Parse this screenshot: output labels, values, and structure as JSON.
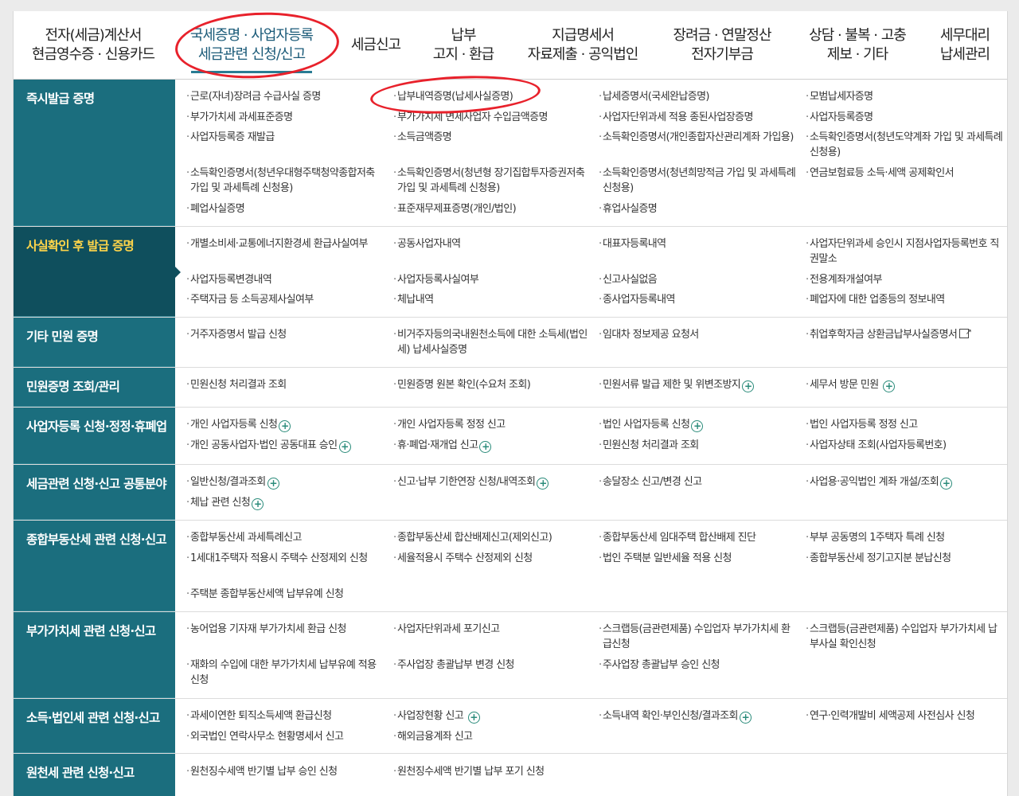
{
  "nav": [
    {
      "line1": "전자(세금)계산서",
      "line2": "현금영수증 · 신용카드"
    },
    {
      "line1": "국세증명 · 사업자등록",
      "line2": "세금관련 신청/신고"
    },
    {
      "line1": "세금신고",
      "line2": ""
    },
    {
      "line1": "납부",
      "line2": "고지 · 환급"
    },
    {
      "line1": "지급명세서",
      "line2": "자료제출 · 공익법인"
    },
    {
      "line1": "장려금 · 연말정산",
      "line2": "전자기부금"
    },
    {
      "line1": "상담 · 불복 · 고충",
      "line2": "제보 · 기타"
    },
    {
      "line1": "세무대리",
      "line2": "납세관리"
    }
  ],
  "sections": [
    {
      "title": "즉시발급 증명",
      "items": [
        "근로(자녀)장려금 수급사실 증명",
        "부가가치세 과세표준증명",
        "사업자등록증 재발급",
        "소득확인증명서(청년우대형주택청약종합저축 가입 및 과세특례 신청용)",
        "폐업사실증명",
        "납부내역증명(납세사실증명)",
        "부가가치세 면세사업자 수입금액증명",
        "소득금액증명",
        "소득확인증명서(청년형 장기집합투자증권저축 가입 및 과세특례 신청용)",
        "표준재무제표증명(개인/법인)",
        "납세증명서(국세완납증명)",
        "사업자단위과세 적용 종된사업장증명",
        "소득확인증명서(개인종합자산관리계좌 가입용)",
        "소득확인증명서(청년희망적금 가입 및 과세특례 신청용)",
        "휴업사실증명",
        "모범납세자증명",
        "사업자등록증명",
        "소득확인증명서(청년도약계좌 가입 및 과세특례 신청용)",
        "연금보험료등 소득·세액 공제확인서"
      ]
    },
    {
      "title": "사실확인 후 발급 증명",
      "items": [
        "개별소비세·교통에너지환경세 환급사실여부",
        "사업자등록변경내역",
        "주택자금 등 소득공제사실여부",
        "공동사업자내역",
        "사업자등록사실여부",
        "체납내역",
        "대표자등록내역",
        "신고사실없음",
        "종사업자등록내역",
        "사업자단위과세 승인시 지점사업자등록번호 직권말소",
        "전용계좌개설여부",
        "폐업자에 대한 업종등의 정보내역"
      ]
    },
    {
      "title": "기타 민원 증명",
      "items": [
        "거주자증명서 발급 신청",
        "비거주자등의국내원천소득에 대한 소득세(법인세) 납세사실증명",
        "임대차 정보제공 요청서",
        "취업후학자금 상환금납부사실증명서"
      ]
    },
    {
      "title": "민원증명 조회/관리",
      "items": [
        "민원신청 처리결과 조회",
        "민원증명 원본 확인(수요처 조회)",
        "민원서류 발급 제한 및 위변조방지",
        "세무서 방문 민원"
      ]
    },
    {
      "title": "사업자등록 신청·정정·휴폐업",
      "items": [
        "개인 사업자등록 신청",
        "개인 공동사업자·법인 공동대표 승인",
        "개인 사업자등록 정정 신고",
        "휴·폐업·재개업 신고",
        "법인 사업자등록 신청",
        "민원신청 처리결과 조회",
        "법인 사업자등록 정정 신고",
        "사업자상태 조회(사업자등록번호)"
      ]
    },
    {
      "title": "세금관련 신청·신고 공통분야",
      "items": [
        "일반신청/결과조회",
        "체납 관련 신청",
        "신고·납부 기한연장 신청/내역조회",
        "송달장소 신고/변경 신고",
        "사업용·공익법인 계좌 개설/조회"
      ]
    },
    {
      "title": "종합부동산세 관련 신청·신고",
      "items": [
        "종합부동산세 과세특례신고",
        "1세대1주택자 적용시 주택수 산정제외 신청",
        "주택분 종합부동산세액 납부유예 신청",
        "종합부동산세 합산배제신고(제외신고)",
        "세율적용시 주택수 산정제외 신청",
        "종합부동산세 임대주택 합산배제 진단",
        "법인 주택분 일반세율 적용 신청",
        "부부 공동명의 1주택자 특례 신청",
        "종합부동산세 정기고지분 분납신청"
      ]
    },
    {
      "title": "부가가치세 관련 신청·신고",
      "items": [
        "농어업용 기자재 부가가치세 환급 신청",
        "재화의 수입에 대한 부가가치세 납부유예 적용 신청",
        "사업자단위과세 포기신고",
        "주사업장 총괄납부 변경 신청",
        "스크랩등(금관련제품) 수입업자 부가가치세 환급신청",
        "주사업장 총괄납부 승인 신청",
        "스크랩등(금관련제품) 수입업자 부가가치세 납부사실 확인신청"
      ]
    },
    {
      "title": "소득·법인세 관련 신청·신고",
      "items": [
        "과세이연한 퇴직소득세액 환급신청",
        "외국법인 연락사무소 현황명세서 신고",
        "사업장현황 신고",
        "해외금융계좌 신고",
        "소득내역 확인·부인신청/결과조회",
        "연구·인력개발비 세액공제 사전심사 신청"
      ]
    },
    {
      "title": "원천세 관련 신청·신고",
      "items": [
        "원천징수세액 반기별 납부 승인 신청",
        "원천징수세액 반기별 납부 포기 신청"
      ]
    }
  ]
}
